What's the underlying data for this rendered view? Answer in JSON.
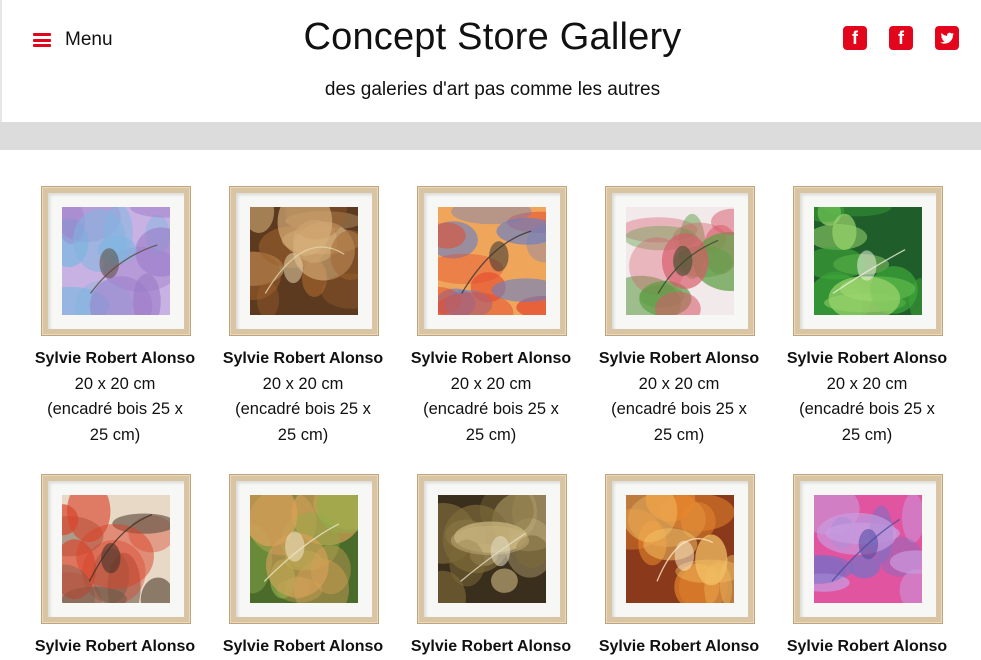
{
  "header": {
    "menu_label": "Menu",
    "title": "Concept Store Gallery",
    "tagline": "des galeries d'art pas comme les autres",
    "social": [
      {
        "icon": "facebook-icon",
        "glyph": "f"
      },
      {
        "icon": "facebook-icon",
        "glyph": "f"
      },
      {
        "icon": "twitter-icon",
        "glyph": ""
      }
    ],
    "accent_color": "#e3051b"
  },
  "gallery": {
    "items": [
      {
        "artist": "Sylvie Robert Alonso",
        "size": "20 x 20 cm",
        "frame_line1": "(encadré bois 25 x",
        "frame_line2": "25 cm)",
        "palette": [
          "#9a7ac8",
          "#7fb6e0",
          "#c8b1e3",
          "#5a4a3a"
        ]
      },
      {
        "artist": "Sylvie Robert Alonso",
        "size": "20 x 20 cm",
        "frame_line1": "(encadré bois 25 x",
        "frame_line2": "25 cm)",
        "palette": [
          "#a0622e",
          "#d7b07a",
          "#5b3a1f",
          "#e7d3a8"
        ]
      },
      {
        "artist": "Sylvie Robert Alonso",
        "size": "20 x 20 cm",
        "frame_line1": "(encadré bois 25 x",
        "frame_line2": "25 cm)",
        "palette": [
          "#e44a2f",
          "#6b7fc4",
          "#f0a65a",
          "#333333"
        ]
      },
      {
        "artist": "Sylvie Robert Alonso",
        "size": "20 x 20 cm",
        "frame_line1": "(encadré bois 25 x",
        "frame_line2": "25 cm)",
        "palette": [
          "#5f9e45",
          "#d95a6a",
          "#f1e9ea",
          "#2f4a28"
        ]
      },
      {
        "artist": "Sylvie Robert Alonso",
        "size": "20 x 20 cm",
        "frame_line1": "(encadré bois 25 x",
        "frame_line2": "25 cm)",
        "palette": [
          "#3fa93a",
          "#9ad46c",
          "#1f5e2a",
          "#e9f2dc"
        ]
      }
    ],
    "second_row": [
      {
        "artist": "Sylvie Robert Alonso",
        "palette": [
          "#d9432a",
          "#6d5a4a",
          "#e8d9c7",
          "#3b2f28"
        ]
      },
      {
        "artist": "Sylvie Robert Alonso",
        "palette": [
          "#8db04a",
          "#d9a15a",
          "#4b6b2a",
          "#efe6c8"
        ]
      },
      {
        "artist": "Sylvie Robert Alonso",
        "palette": [
          "#7d6a3a",
          "#c9b680",
          "#3a2e1c",
          "#e6dfc6"
        ]
      },
      {
        "artist": "Sylvie Robert Alonso",
        "palette": [
          "#e8872e",
          "#f3c064",
          "#8a3a1a",
          "#fbe9c9"
        ]
      },
      {
        "artist": "Sylvie Robert Alonso",
        "palette": [
          "#7a6fc4",
          "#c99be0",
          "#e054a0",
          "#4a4aa0"
        ]
      }
    ]
  }
}
